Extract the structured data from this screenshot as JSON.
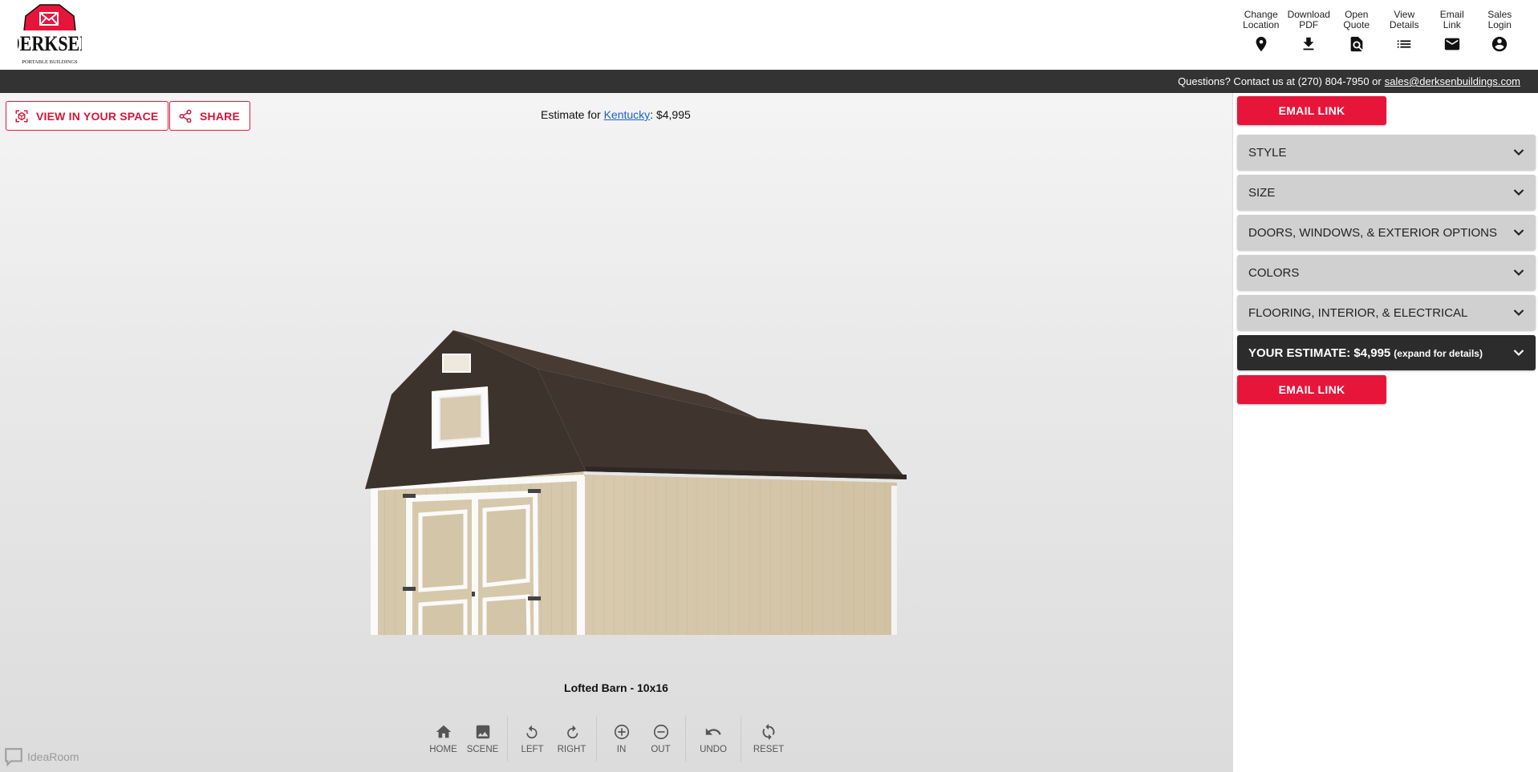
{
  "brand": {
    "name": "DERKSEN",
    "tagline": "PORTABLE BUILDINGS",
    "colors": {
      "accent": "#e8153b",
      "dark_bar": "#333333",
      "accordion": "#d0d0d0"
    }
  },
  "top_actions": [
    {
      "label": "Change\nLocation",
      "icon": "location-pin-icon"
    },
    {
      "label": "Download\nPDF",
      "icon": "download-icon"
    },
    {
      "label": "Open\nQuote",
      "icon": "find-document-icon"
    },
    {
      "label": "View\nDetails",
      "icon": "list-icon"
    },
    {
      "label": "Email\nLink",
      "icon": "mail-icon"
    },
    {
      "label": "Sales\nLogin",
      "icon": "account-circle-icon"
    }
  ],
  "contact": {
    "text": "Questions? Contact us at (270) 804-7950 or",
    "email": "sales@derksenbuildings.com"
  },
  "viewer": {
    "view_in_space_label": "VIEW IN YOUR SPACE",
    "share_label": "SHARE",
    "estimate_prefix": "Estimate for",
    "estimate_location": "Kentucky",
    "estimate_suffix": ": $4,995",
    "model_name": "Lofted Barn - 10x16",
    "controls": [
      [
        {
          "label": "HOME",
          "icon": "home-icon"
        },
        {
          "label": "SCENE",
          "icon": "image-icon"
        }
      ],
      [
        {
          "label": "LEFT",
          "icon": "rotate-left-icon"
        },
        {
          "label": "RIGHT",
          "icon": "rotate-right-icon"
        }
      ],
      [
        {
          "label": "IN",
          "icon": "zoom-in-icon"
        },
        {
          "label": "OUT",
          "icon": "zoom-out-icon"
        }
      ],
      [
        {
          "label": "UNDO",
          "icon": "undo-icon"
        }
      ],
      [
        {
          "label": "RESET",
          "icon": "reset-icon"
        }
      ]
    ],
    "powered_by": "IdeaRoom"
  },
  "sidebar": {
    "email_link_label": "EMAIL LINK",
    "sections": [
      {
        "label": "STYLE"
      },
      {
        "label": "SIZE"
      },
      {
        "label": "DOORS, WINDOWS, & EXTERIOR OPTIONS"
      },
      {
        "label": "COLORS"
      },
      {
        "label": "FLOORING, INTERIOR, & ELECTRICAL"
      }
    ],
    "estimate_label": "YOUR ESTIMATE: $4,995",
    "estimate_hint": "(expand for details)"
  }
}
